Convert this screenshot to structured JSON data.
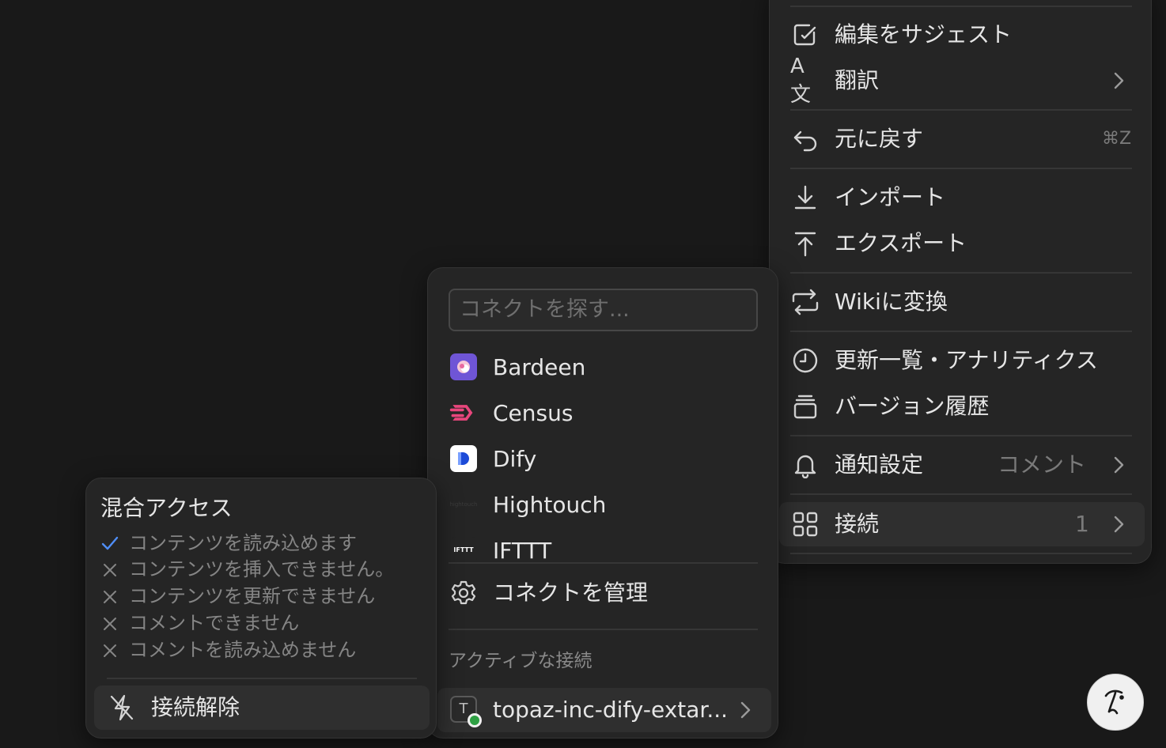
{
  "main_menu": {
    "suggest_edit": "編集をサジェスト",
    "translate": "翻訳",
    "undo": "元に戻す",
    "undo_shortcut": "⌘Z",
    "import": "インポート",
    "export": "エクスポート",
    "to_wiki": "Wikiに変換",
    "updates_analytics": "更新一覧・アナリティクス",
    "version_history": "バージョン履歴",
    "notifications": "通知設定",
    "notifications_value": "コメント",
    "connections": "接続",
    "connections_count": "1"
  },
  "connect_menu": {
    "search_placeholder": "コネクトを探す...",
    "apps": [
      "Bardeen",
      "Census",
      "Dify",
      "Hightouch",
      "IFTTT"
    ],
    "manage": "コネクトを管理",
    "active_section": "アクティブな接続",
    "active_connection": "topaz-inc-dify-extar..."
  },
  "access_menu": {
    "title": "混合アクセス",
    "permissions": [
      "コンテンツを読み込めます",
      "コンテンツを挿入できません。",
      "コンテンツを更新できません",
      "コメントできません",
      "コメントを読み込めません"
    ],
    "disconnect": "接続解除"
  },
  "colors": {
    "background": "#191919",
    "panel": "#252525",
    "check": "#4f8ef7",
    "bardeen": "#6f55d6",
    "census": "#e8467c",
    "dify": "#1c4bd8",
    "online": "#2ea043"
  },
  "icons": {
    "ifttt_text": "IFTTT",
    "hightouch_text": "hightouch",
    "connection_initial": "T"
  }
}
